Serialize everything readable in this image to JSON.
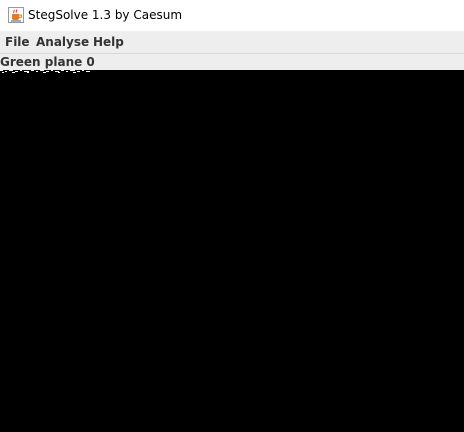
{
  "window": {
    "title": "StegSolve 1.3 by Caesum",
    "icon": "java-cup-icon"
  },
  "menubar": {
    "items": [
      {
        "label": "File"
      },
      {
        "label": "Analyse"
      },
      {
        "label": "Help"
      }
    ]
  },
  "viewer": {
    "plane_label": "Green plane 0",
    "background_color": "#000000"
  }
}
